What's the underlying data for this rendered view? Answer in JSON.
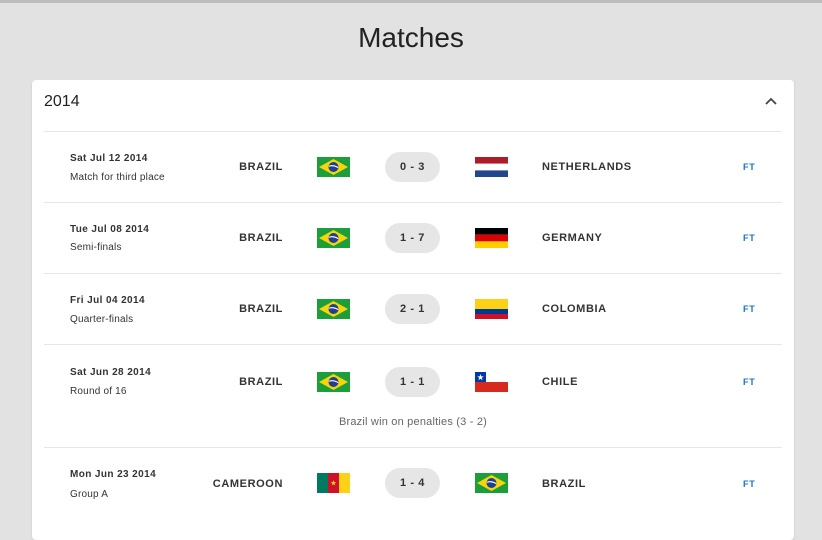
{
  "page": {
    "title": "Matches"
  },
  "section": {
    "year": "2014",
    "collapse_icon": "chevron-up-icon"
  },
  "matches": [
    {
      "date": "Sat Jul 12 2014",
      "round": "Match for third place",
      "home": "BRAZIL",
      "home_flag": "brazil-flag-icon",
      "score": "0 - 3",
      "away": "NETHERLANDS",
      "away_flag": "netherlands-flag-icon",
      "status": "FT"
    },
    {
      "date": "Tue Jul 08 2014",
      "round": "Semi-finals",
      "home": "BRAZIL",
      "home_flag": "brazil-flag-icon",
      "score": "1 - 7",
      "away": "GERMANY",
      "away_flag": "germany-flag-icon",
      "status": "FT"
    },
    {
      "date": "Fri Jul 04 2014",
      "round": "Quarter-finals",
      "home": "BRAZIL",
      "home_flag": "brazil-flag-icon",
      "score": "2 - 1",
      "away": "COLOMBIA",
      "away_flag": "colombia-flag-icon",
      "status": "FT"
    },
    {
      "date": "Sat Jun 28 2014",
      "round": "Round of 16",
      "home": "BRAZIL",
      "home_flag": "brazil-flag-icon",
      "score": "1 - 1",
      "away": "CHILE",
      "away_flag": "chile-flag-icon",
      "status": "FT",
      "note": "Brazil win on penalties (3 - 2)"
    },
    {
      "date": "Mon Jun 23 2014",
      "round": "Group A",
      "home": "CAMEROON",
      "home_flag": "cameroon-flag-icon",
      "score": "1 - 4",
      "away": "BRAZIL",
      "away_flag": "brazil-flag-icon",
      "status": "FT"
    }
  ],
  "colors": {
    "background": "#e2e2e2",
    "card": "#ffffff",
    "score_pill": "#e6e6e6",
    "status_link": "#1a73c8"
  }
}
